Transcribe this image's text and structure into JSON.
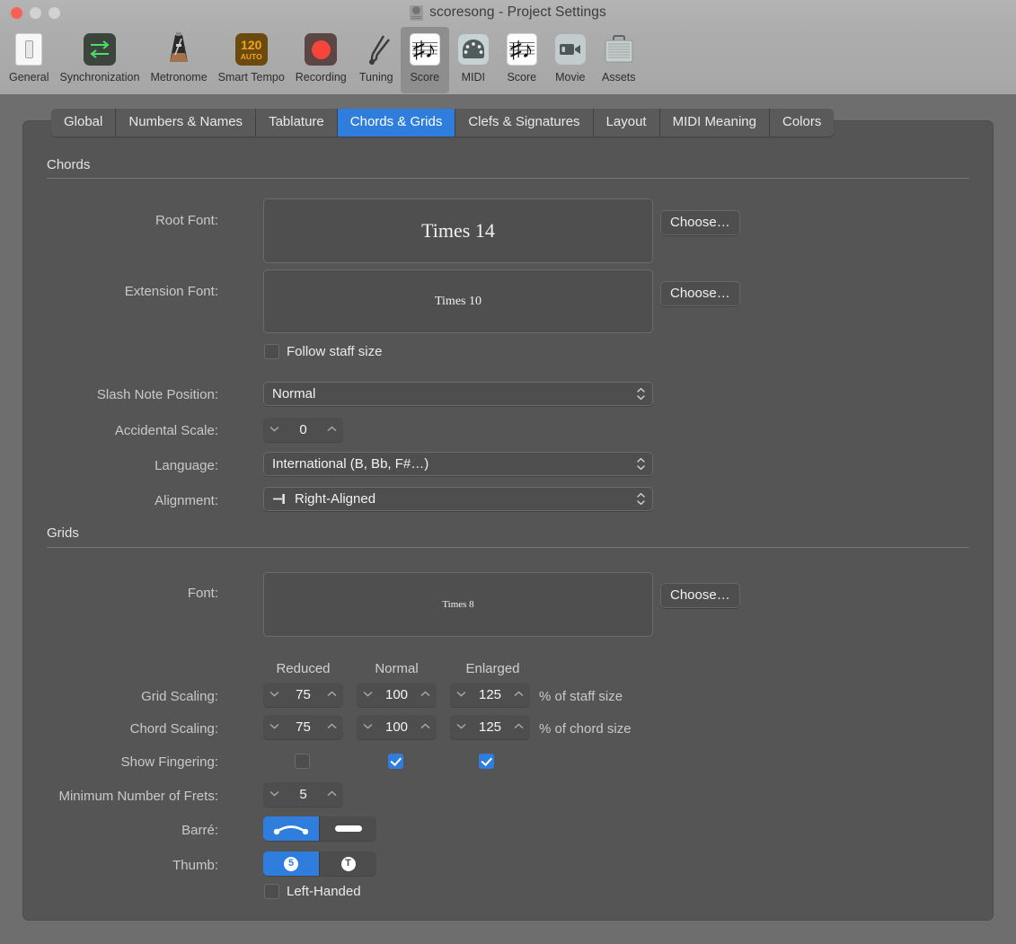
{
  "window": {
    "title": "scoresong - Project Settings",
    "doc_icon": "score-document-icon",
    "traffic": {
      "close": "close-window",
      "minimize": "minimize-window",
      "maximize": "maximize-window"
    }
  },
  "toolbar": {
    "items": [
      {
        "label": "General",
        "icon": "toggle-switch-icon",
        "selected": false
      },
      {
        "label": "Synchronization",
        "icon": "sync-arrows-icon",
        "selected": false
      },
      {
        "label": "Metronome",
        "icon": "metronome-icon",
        "selected": false
      },
      {
        "label": "Smart Tempo",
        "icon": "tempo-120-auto-icon",
        "selected": false,
        "badge_top": "120",
        "badge_bottom": "AUTO"
      },
      {
        "label": "Recording",
        "icon": "record-dot-icon",
        "selected": false
      },
      {
        "label": "Tuning",
        "icon": "tuning-fork-icon",
        "selected": false
      },
      {
        "label": "Score",
        "icon": "score-note-icon",
        "selected": true
      },
      {
        "label": "MIDI",
        "icon": "midi-connector-icon",
        "selected": false
      },
      {
        "label": "Score",
        "icon": "score-note-icon",
        "selected": false
      },
      {
        "label": "Movie",
        "icon": "movie-camera-icon",
        "selected": false
      },
      {
        "label": "Assets",
        "icon": "briefcase-icon",
        "selected": false
      }
    ]
  },
  "tabs": [
    {
      "label": "Global",
      "active": false
    },
    {
      "label": "Numbers & Names",
      "active": false
    },
    {
      "label": "Tablature",
      "active": false
    },
    {
      "label": "Chords & Grids",
      "active": true
    },
    {
      "label": "Clefs & Signatures",
      "active": false
    },
    {
      "label": "Layout",
      "active": false
    },
    {
      "label": "MIDI Meaning",
      "active": false
    },
    {
      "label": "Colors",
      "active": false
    }
  ],
  "chords": {
    "section_title": "Chords",
    "root_font": {
      "label": "Root Font:",
      "value": "Times 14",
      "button": "Choose…"
    },
    "extension_font": {
      "label": "Extension Font:",
      "value": "Times 10",
      "button": "Choose…"
    },
    "follow_staff_size": {
      "label": "Follow staff size",
      "checked": false
    },
    "slash_note_position": {
      "label": "Slash Note Position:",
      "value": "Normal"
    },
    "accidental_scale": {
      "label": "Accidental Scale:",
      "value": "0"
    },
    "language": {
      "label": "Language:",
      "value": "International (B, Bb, F#…)"
    },
    "alignment": {
      "label": "Alignment:",
      "value": "Right-Aligned",
      "glyph": "right-align-icon"
    }
  },
  "grids": {
    "section_title": "Grids",
    "font": {
      "label": "Font:",
      "value": "Times 8",
      "button": "Choose…"
    },
    "columns": [
      "Reduced",
      "Normal",
      "Enlarged"
    ],
    "grid_scaling": {
      "label": "Grid Scaling:",
      "values": [
        "75",
        "100",
        "125"
      ],
      "unit": "% of staff size"
    },
    "chord_scaling": {
      "label": "Chord Scaling:",
      "values": [
        "75",
        "100",
        "125"
      ],
      "unit": "% of chord size"
    },
    "show_fingering": {
      "label": "Show Fingering:",
      "checked": [
        false,
        true,
        true
      ]
    },
    "minimum_frets": {
      "label": "Minimum Number of Frets:",
      "value": "5"
    },
    "barre": {
      "label": "Barré:",
      "options": [
        {
          "icon": "barre-curve-icon",
          "selected": true
        },
        {
          "icon": "barre-bar-icon",
          "selected": false
        }
      ]
    },
    "thumb": {
      "label": "Thumb:",
      "options": [
        {
          "icon": "thumb-number-5-icon",
          "glyph": "5",
          "selected": true
        },
        {
          "icon": "thumb-letter-t-icon",
          "glyph": "T",
          "selected": false
        }
      ]
    },
    "left_handed": {
      "label": "Left-Handed",
      "checked": false
    }
  },
  "colors": {
    "accent": "#2f7ede",
    "panel_bg": "#555555",
    "window_bg": "#6e6e6e",
    "titlebar_bg": "#b0b0b0"
  }
}
